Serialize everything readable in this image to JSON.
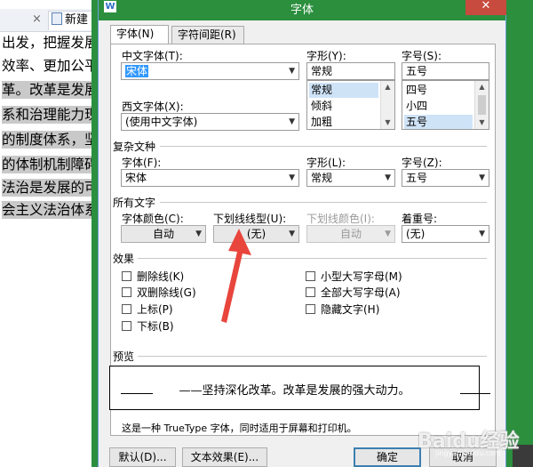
{
  "document": {
    "tab_label": "新建",
    "tab_close": "×",
    "lines": [
      "出发，把握发展",
      "效率、更加公平",
      "革。改革是发展",
      "系和治理能力现",
      "的制度体系，坚",
      "的体制机制障碍",
      "法治是发展的可",
      "会主义法治体系"
    ]
  },
  "dialog": {
    "title": "字体",
    "app_icon": "W",
    "close": "✕",
    "tabs": {
      "font": "字体(N)",
      "spacing": "字符间距(R)"
    },
    "chinese_font": {
      "label": "中文字体(T):",
      "value": "宋体"
    },
    "western_font": {
      "label": "西文字体(X):",
      "value": "(使用中文字体)"
    },
    "style": {
      "label": "字形(Y):",
      "value": "常规",
      "options": [
        "常规",
        "倾斜",
        "加粗"
      ],
      "selected": "常规"
    },
    "size": {
      "label": "字号(S):",
      "value": "五号",
      "options": [
        "四号",
        "小四",
        "五号"
      ],
      "selected": "五号"
    },
    "complex": {
      "section": "复杂文种",
      "font_label": "字体(F):",
      "font_value": "宋体",
      "style_label": "字形(L):",
      "style_value": "常规",
      "size_label": "字号(Z):",
      "size_value": "五号"
    },
    "all_text": {
      "section": "所有文字",
      "color_label": "字体颜色(C):",
      "color_value": "自动",
      "underline_label": "下划线线型(U):",
      "underline_value": "(无)",
      "underline_color_label": "下划线颜色(I):",
      "underline_color_value": "自动",
      "emphasis_label": "着重号:",
      "emphasis_value": "(无)"
    },
    "effects": {
      "section": "效果",
      "left": [
        "删除线(K)",
        "双删除线(G)",
        "上标(P)",
        "下标(B)"
      ],
      "right": [
        "小型大写字母(M)",
        "全部大写字母(A)",
        "隐藏文字(H)"
      ]
    },
    "preview": {
      "section": "预览",
      "text": "——坚持深化改革。改革是发展的强大动力。",
      "note": "这是一种 TrueType 字体，同时适用于屏幕和打印机。"
    },
    "buttons": {
      "default": "默认(D)...",
      "text_effects": "文本效果(E)...",
      "ok": "确定",
      "cancel": "取消"
    }
  },
  "watermark": {
    "text": "Baidu经验",
    "sub": "jingyan.baidu.com"
  },
  "colors": {
    "title_bar": "#2b8f3e",
    "close_button": "#c74b3e",
    "arrow": "#e8453c",
    "selection": "#3399ff"
  },
  "icons": {
    "app": "wps-writer-icon",
    "dropdown": "chevron-down-icon",
    "close": "close-icon"
  }
}
